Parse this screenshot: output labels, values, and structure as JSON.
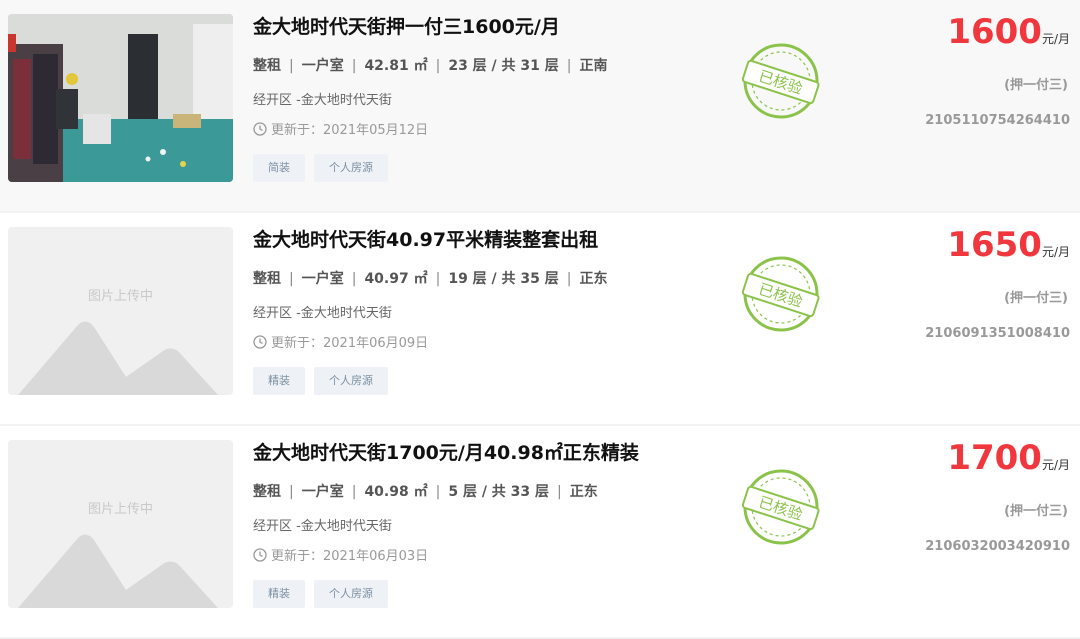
{
  "listings": [
    {
      "title": "金大地时代天街押一付三1600元/月",
      "rent_type": "整租",
      "layout": "一户室",
      "area": "42.81 ㎡",
      "floor": "23 层 / 共 31 层",
      "orientation": "正南",
      "location": "经开区 -金大地时代天街",
      "updated": "更新于：2021年05月12日",
      "tags": [
        "简装",
        "个人房源"
      ],
      "stamp": "已核验",
      "price": "1600",
      "price_unit": "元/月",
      "deposit": "(押一付三)",
      "code": "2105110754264410",
      "has_photo": true,
      "photo_placeholder": ""
    },
    {
      "title": "金大地时代天街40.97平米精装整套出租",
      "rent_type": "整租",
      "layout": "一户室",
      "area": "40.97 ㎡",
      "floor": "19 层 / 共 35 层",
      "orientation": "正东",
      "location": "经开区 -金大地时代天街",
      "updated": "更新于：2021年06月09日",
      "tags": [
        "精装",
        "个人房源"
      ],
      "stamp": "已核验",
      "price": "1650",
      "price_unit": "元/月",
      "deposit": "(押一付三)",
      "code": "2106091351008410",
      "has_photo": false,
      "photo_placeholder": "图片上传中"
    },
    {
      "title": "金大地时代天街1700元/月40.98㎡正东精装",
      "rent_type": "整租",
      "layout": "一户室",
      "area": "40.98 ㎡",
      "floor": "5 层 / 共 33 层",
      "orientation": "正东",
      "location": "经开区 -金大地时代天街",
      "updated": "更新于：2021年06月03日",
      "tags": [
        "精装",
        "个人房源"
      ],
      "stamp": "已核验",
      "price": "1700",
      "price_unit": "元/月",
      "deposit": "(押一付三)",
      "code": "2106032003420910",
      "has_photo": false,
      "photo_placeholder": "图片上传中"
    }
  ],
  "colors": {
    "price": "#f0373d",
    "stamp": "#8bc34a",
    "tag_bg": "#eef2f6",
    "tag_text": "#7d8fa3"
  }
}
